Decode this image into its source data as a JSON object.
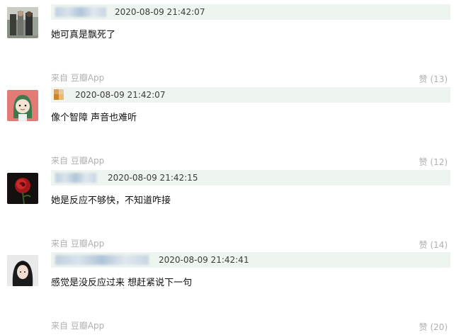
{
  "comments": [
    {
      "timestamp": "2020-08-09 21:42:07",
      "text": "她可真是飘死了",
      "source": "来自 豆瓣App",
      "likes": "赞 (13)",
      "avatar": "people-photo-avatar"
    },
    {
      "timestamp": "2020-08-09 21:42:07",
      "text": "像个智障 声音也难听",
      "source": "来自 豆瓣App",
      "likes": "赞 (12)",
      "avatar": "cartoon-green-hood-avatar"
    },
    {
      "timestamp": "2020-08-09 21:42:15",
      "text": "她是反应不够快，不知道咋接",
      "source": "来自 豆瓣App",
      "likes": "赞 (14)",
      "avatar": "red-flower-avatar"
    },
    {
      "timestamp": "2020-08-09 21:42:41",
      "text": "感觉是没反应过来 想赶紧说下一句",
      "source": "来自 豆瓣App",
      "likes": "赞 (20)",
      "avatar": "dark-hair-person-avatar"
    }
  ],
  "colors": {
    "header_bg": "#eef4ef",
    "meta_text": "#b0b0b0",
    "body_text": "#111111"
  }
}
